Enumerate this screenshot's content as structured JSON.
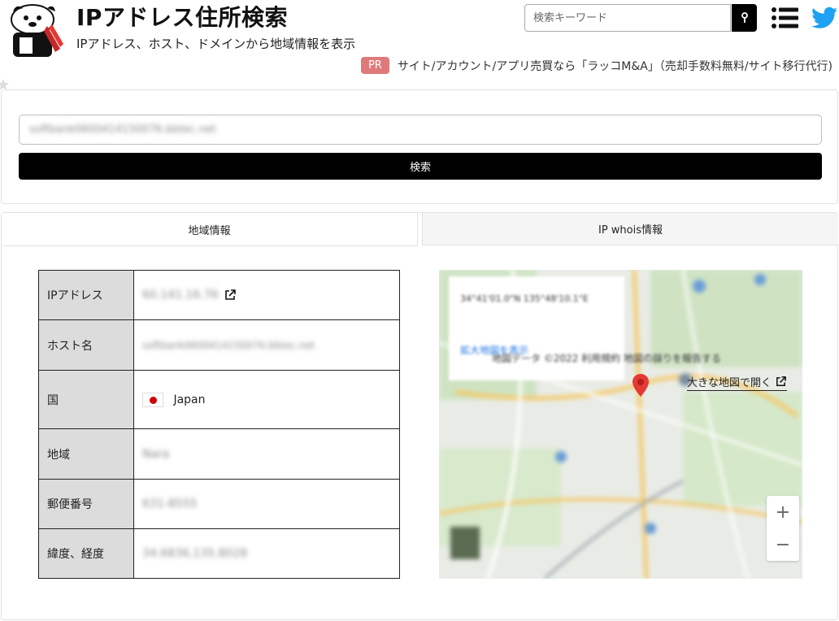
{
  "header": {
    "title": "IPアドレス住所検索",
    "subtitle": "IPアドレス、ホスト、ドメインから地域情報を表示",
    "search_placeholder": "検索キーワード",
    "search_button_icon": "search-icon",
    "menu_icon": "hamburger-menu-icon",
    "social_icon": "twitter-icon",
    "twitter_color": "#1da1f2"
  },
  "promo": {
    "badge": "PR",
    "text": "サイト/アカウント/アプリ売買なら「ラッコM&A」（売却手数料無料/サイト移行代行)",
    "badge_color": "#e07a7a"
  },
  "lookup": {
    "input_value": "softbank0600414150076.bbtec.net",
    "submit_label": "検索"
  },
  "tabs": [
    {
      "label": "地域情報",
      "active": true
    },
    {
      "label": "IP whois情報",
      "active": false
    }
  ],
  "info": {
    "rows": [
      {
        "label": "IPアドレス",
        "value": "60.141.16.76"
      },
      {
        "label": "ホスト名",
        "value": "softbank0600414150076.bbtec.net"
      },
      {
        "label": "国",
        "value": "Japan"
      },
      {
        "label": "地域",
        "value": "Nara"
      },
      {
        "label": "郵便番号",
        "value": "631-8555"
      },
      {
        "label": "緯度、経度",
        "value": "34.6836,135.8028"
      }
    ]
  },
  "map": {
    "popup_text": "34°41'01.0\"N 135°48'10.1\"E",
    "popup_link": "拡大地図を表示",
    "zoom_in": "+",
    "zoom_out": "−",
    "footer": "地図データ ©2022 利用規約 地図の誤りを報告する",
    "big_map_link": "大きな地図で開く",
    "pin_color": "#e53935"
  }
}
